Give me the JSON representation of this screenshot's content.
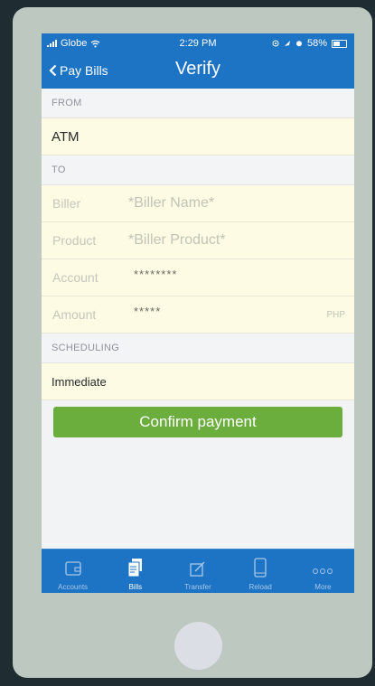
{
  "status_bar": {
    "carrier": "Globe",
    "time": "2:29 PM",
    "battery": "58%"
  },
  "nav": {
    "back_label": "Pay Bills",
    "title": "Verify"
  },
  "from": {
    "header": "FROM",
    "value": "ATM"
  },
  "to": {
    "header": "TO",
    "fields": [
      {
        "label": "Biller",
        "value": "*Biller Name*"
      },
      {
        "label": "Product",
        "value": "*Biller Product*"
      },
      {
        "label": "Account",
        "value": "********"
      },
      {
        "label": "Amount",
        "value": "*****",
        "unit": "PHP"
      }
    ]
  },
  "scheduling": {
    "header": "SCHEDULING",
    "value": "Immediate"
  },
  "confirm_label": "Confirm payment",
  "tabs": [
    {
      "label": "Accounts",
      "icon": "wallet-icon"
    },
    {
      "label": "Bills",
      "icon": "bills-icon",
      "active": true
    },
    {
      "label": "Transfer",
      "icon": "transfer-icon"
    },
    {
      "label": "Reload",
      "icon": "phone-icon"
    },
    {
      "label": "More",
      "icon": "more-icon"
    }
  ],
  "colors": {
    "primary": "#1d73c4",
    "confirm": "#6cae3e",
    "field_bg": "#fdfbe4",
    "device": "#bdc8c1",
    "background": "#1f2d33"
  }
}
